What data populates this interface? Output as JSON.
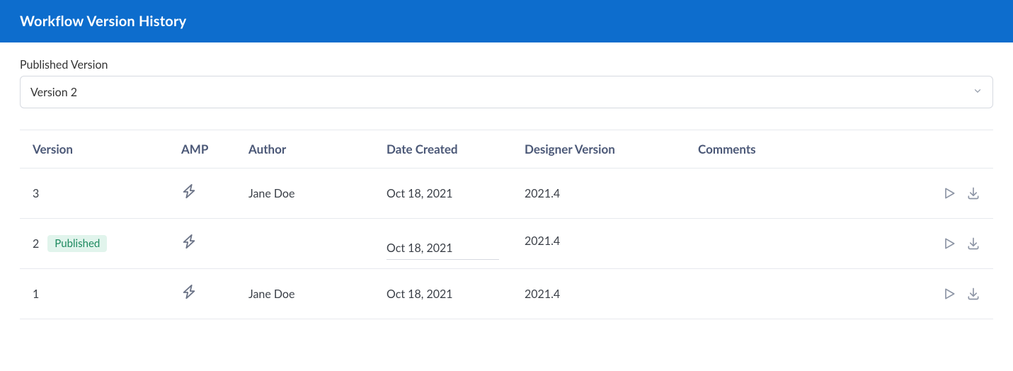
{
  "header": {
    "title": "Workflow Version History"
  },
  "published_select": {
    "label": "Published Version",
    "value": "Version 2"
  },
  "table": {
    "columns": {
      "version": "Version",
      "amp": "AMP",
      "author": "Author",
      "date_created": "Date Created",
      "designer_version": "Designer Version",
      "comments": "Comments"
    },
    "rows": [
      {
        "version": "3",
        "published": false,
        "author": "Jane Doe",
        "date_created": "Oct 18, 2021",
        "designer_version": "2021.4",
        "comments": ""
      },
      {
        "version": "2",
        "published": true,
        "published_label": "Published",
        "author": "",
        "date_created": "Oct 18, 2021",
        "designer_version": "2021.4",
        "comments": ""
      },
      {
        "version": "1",
        "published": false,
        "author": "Jane Doe",
        "date_created": "Oct 18, 2021",
        "designer_version": "2021.4",
        "comments": ""
      }
    ]
  },
  "icons": {
    "amp": "lightning-icon",
    "play": "play-icon",
    "download": "download-icon",
    "chevron": "chevron-down-icon"
  }
}
